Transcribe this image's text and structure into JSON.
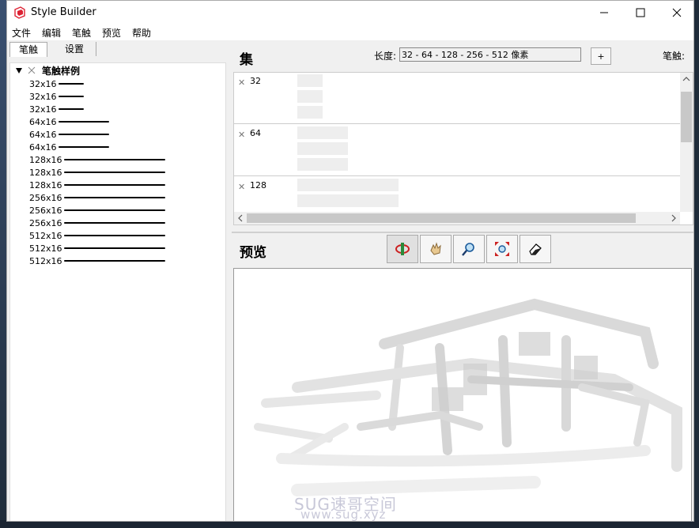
{
  "window": {
    "title": "Style Builder"
  },
  "menu": [
    "文件",
    "编辑",
    "笔触",
    "预览",
    "帮助"
  ],
  "left_tabs": {
    "active": "笔触",
    "inactive": "设置"
  },
  "tree": {
    "root_label": "笔触样例",
    "items": [
      {
        "label": "32x16",
        "length": 32
      },
      {
        "label": "32x16",
        "length": 32
      },
      {
        "label": "32x16",
        "length": 32
      },
      {
        "label": "64x16",
        "length": 64
      },
      {
        "label": "64x16",
        "length": 64
      },
      {
        "label": "64x16",
        "length": 64
      },
      {
        "label": "128x16",
        "length": 128
      },
      {
        "label": "128x16",
        "length": 128
      },
      {
        "label": "128x16",
        "length": 128
      },
      {
        "label": "256x16",
        "length": 256
      },
      {
        "label": "256x16",
        "length": 256
      },
      {
        "label": "256x16",
        "length": 256
      },
      {
        "label": "512x16",
        "length": 512
      },
      {
        "label": "512x16",
        "length": 512
      },
      {
        "label": "512x16",
        "length": 512
      }
    ]
  },
  "sets": {
    "title": "集",
    "length_label": "长度:",
    "length_value": "32 - 64 - 128 - 256 - 512 像素",
    "add_label": "+",
    "stroke_label": "笔触:",
    "groups": [
      {
        "length": "32"
      },
      {
        "length": "64"
      },
      {
        "length": "128"
      }
    ]
  },
  "preview": {
    "title": "预览"
  },
  "watermark": {
    "line1": "SUG速哥空间",
    "line2": "www.sug.xyz"
  }
}
